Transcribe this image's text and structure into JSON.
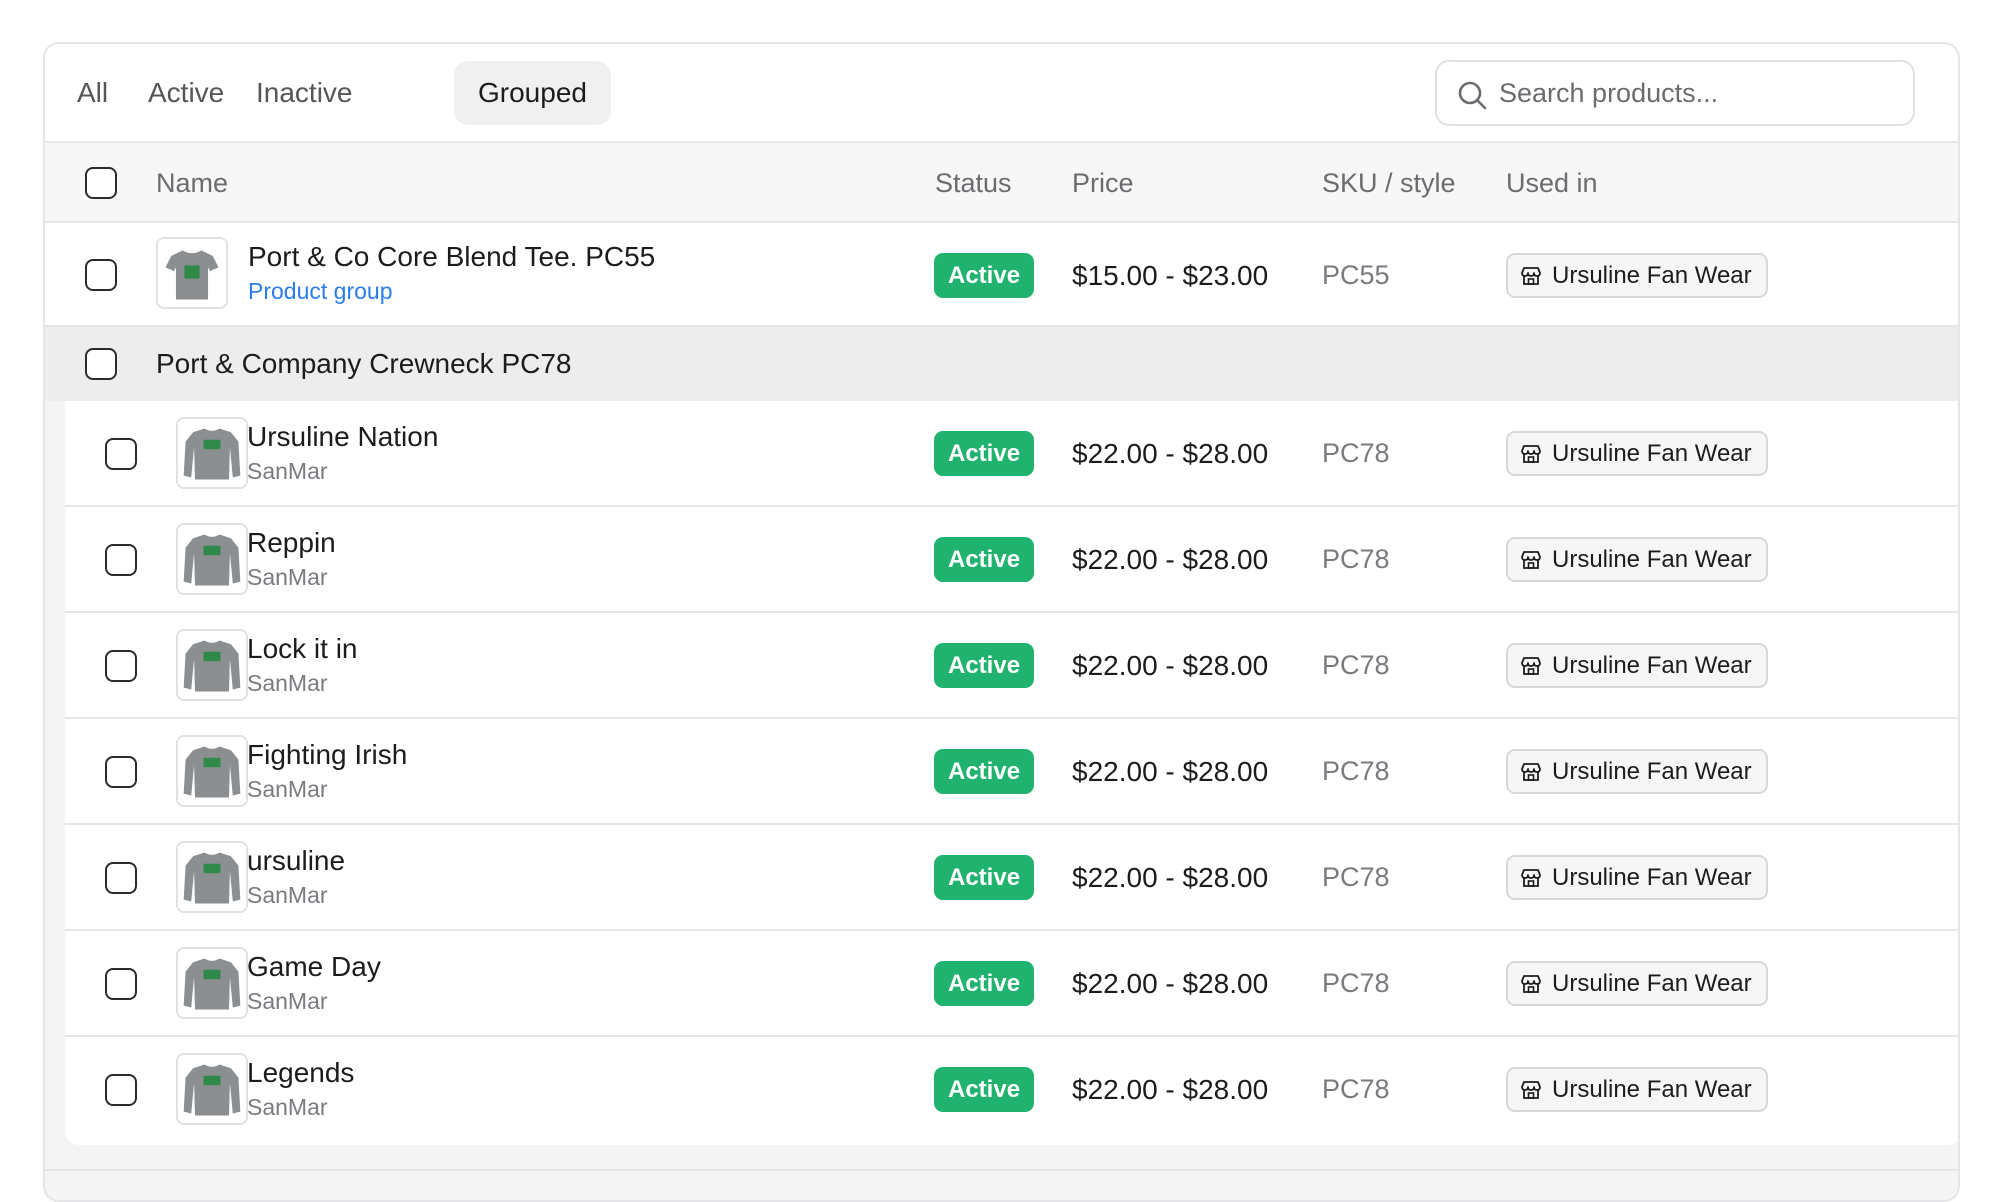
{
  "tabs": [
    {
      "label": "All",
      "selected": false
    },
    {
      "label": "Active",
      "selected": false
    },
    {
      "label": "Inactive",
      "selected": false
    },
    {
      "label": "Grouped",
      "selected": true
    }
  ],
  "search": {
    "placeholder": "Search products..."
  },
  "columns": {
    "name": "Name",
    "status": "Status",
    "price": "Price",
    "sku": "SKU / style",
    "used_in": "Used in"
  },
  "top_row": {
    "name": "Port & Co Core Blend Tee. PC55",
    "subtitle": "Product group",
    "status": "Active",
    "price": "$15.00 - $23.00",
    "sku": "PC55",
    "used_in": "Ursuline Fan Wear"
  },
  "group": {
    "title": "Port & Company Crewneck PC78",
    "rows": [
      {
        "name": "Ursuline Nation",
        "vendor": "SanMar",
        "status": "Active",
        "price": "$22.00 - $28.00",
        "sku": "PC78",
        "used_in": "Ursuline Fan Wear"
      },
      {
        "name": "Reppin",
        "vendor": "SanMar",
        "status": "Active",
        "price": "$22.00 - $28.00",
        "sku": "PC78",
        "used_in": "Ursuline Fan Wear"
      },
      {
        "name": "Lock it in",
        "vendor": "SanMar",
        "status": "Active",
        "price": "$22.00 - $28.00",
        "sku": "PC78",
        "used_in": "Ursuline Fan Wear"
      },
      {
        "name": "Fighting Irish",
        "vendor": "SanMar",
        "status": "Active",
        "price": "$22.00 - $28.00",
        "sku": "PC78",
        "used_in": "Ursuline Fan Wear"
      },
      {
        "name": "ursuline",
        "vendor": "SanMar",
        "status": "Active",
        "price": "$22.00 - $28.00",
        "sku": "PC78",
        "used_in": "Ursuline Fan Wear"
      },
      {
        "name": "Game Day",
        "vendor": "SanMar",
        "status": "Active",
        "price": "$22.00 - $28.00",
        "sku": "PC78",
        "used_in": "Ursuline Fan Wear"
      },
      {
        "name": "Legends",
        "vendor": "SanMar",
        "status": "Active",
        "price": "$22.00 - $28.00",
        "sku": "PC78",
        "used_in": "Ursuline Fan Wear"
      }
    ]
  },
  "colors": {
    "accent_green": "#1fb36f",
    "link_blue": "#2b7de9",
    "shirt_gray": "#8c8f91",
    "print_green": "#1e8a3c"
  },
  "icons": {
    "search": "search-icon",
    "store": "store-icon",
    "thumbnail": "sweatshirt-thumbnail"
  }
}
